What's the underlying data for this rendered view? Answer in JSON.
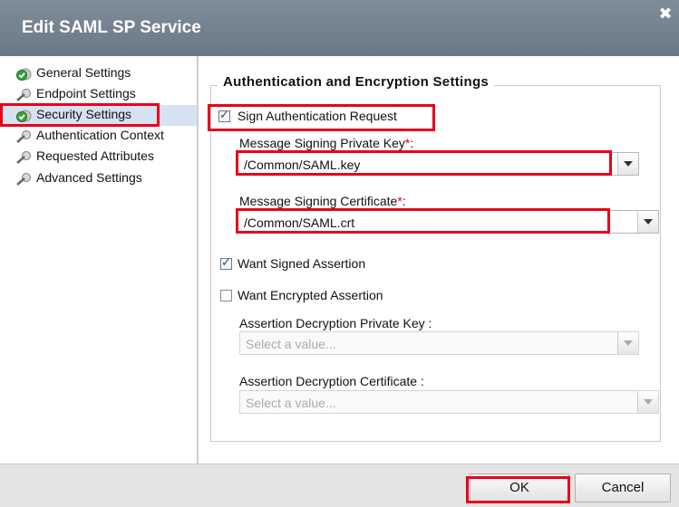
{
  "dialog": {
    "title": "Edit SAML SP Service",
    "close_glyph": "✖"
  },
  "nav": {
    "items": [
      {
        "label": "General Settings",
        "icon": "green-check-icon"
      },
      {
        "label": "Endpoint Settings",
        "icon": "gear-tool-icon"
      },
      {
        "label": "Security Settings",
        "icon": "green-check-icon",
        "selected": true
      },
      {
        "label": "Authentication Context",
        "icon": "gear-tool-icon"
      },
      {
        "label": "Requested Attributes",
        "icon": "gear-tool-icon"
      },
      {
        "label": "Advanced Settings",
        "icon": "gear-tool-icon"
      }
    ]
  },
  "section": {
    "legend": "Authentication and Encryption Settings",
    "sign_request": {
      "label": "Sign Authentication Request",
      "checked": true
    },
    "signing_key": {
      "label": "Message Signing Private Key",
      "required_mark": "*",
      "suffix": ":",
      "value": "/Common/SAML.key"
    },
    "signing_cert": {
      "label": "Message Signing Certificate",
      "required_mark": "*",
      "suffix": ":",
      "value": "/Common/SAML.crt"
    },
    "want_signed": {
      "label": "Want Signed Assertion",
      "checked": true
    },
    "want_encrypted": {
      "label": "Want Encrypted Assertion",
      "checked": false
    },
    "decrypt_key": {
      "label": "Assertion Decryption Private Key :",
      "placeholder": "Select a value..."
    },
    "decrypt_cert": {
      "label": "Assertion Decryption Certificate :",
      "placeholder": "Select a value..."
    }
  },
  "footer": {
    "ok_label": "OK",
    "cancel_label": "Cancel"
  },
  "colors": {
    "titlebar": "#76838f",
    "highlight": "#e8001b",
    "selected_row": "#d6e2f2"
  }
}
